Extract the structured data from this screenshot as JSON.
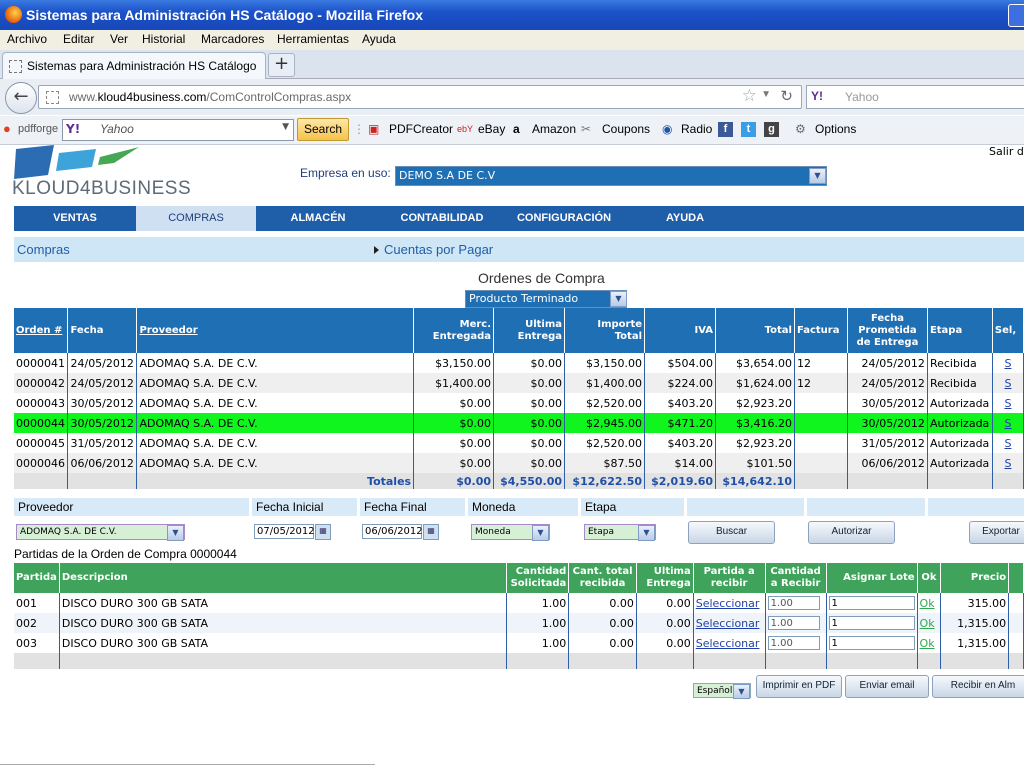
{
  "window": {
    "title": "Sistemas para Administración HS Catálogo - Mozilla Firefox"
  },
  "menubar": [
    "Archivo",
    "Editar",
    "Ver",
    "Historial",
    "Marcadores",
    "Herramientas",
    "Ayuda"
  ],
  "tab": {
    "label": "Sistemas para Administración HS Catálogo",
    "new_tab": "+"
  },
  "urlbar": {
    "prefix": "www.",
    "domain": "kloud4business.com",
    "path": "/ComControlCompras.aspx",
    "search_placeholder": "Yahoo",
    "search_engine": "Y!"
  },
  "toolbar": {
    "pdfforge": "pdfforge",
    "yahoo_logo": "Y!",
    "search_placeholder": "Yahoo",
    "search_button": "Search",
    "items": [
      "PDFCreator",
      "eBay",
      "Amazon",
      "Coupons",
      "Radio",
      "Options"
    ]
  },
  "app": {
    "logo": "KLOUD4BUSINESS",
    "empresa_label": "Empresa en uso:",
    "empresa_value": "DEMO S.A DE C.V",
    "salir": "Salir d",
    "nav": [
      "VENTAS",
      "COMPRAS",
      "ALMACÉN",
      "CONTABILIDAD",
      "CONFIGURACIÓN",
      "AYUDA"
    ],
    "breadcrumb": "Compras",
    "sublink": "Cuentas por Pagar"
  },
  "orders": {
    "title": "Ordenes de Compra",
    "tipo": "Producto Terminado",
    "headers": [
      "Orden #",
      "Fecha",
      "Proveedor",
      "Merc. Entregada",
      "Ultima Entrega",
      "Importe Total",
      "IVA",
      "Total",
      "Factura",
      "Fecha Prometida de Entrega",
      "Etapa",
      "Sel,"
    ],
    "rows": [
      {
        "orden": "0000041",
        "fecha": "24/05/2012",
        "proveedor": "ADOMAQ S.A. DE C.V.",
        "merc": "$3,150.00",
        "ultima": "$0.00",
        "importe": "$3,150.00",
        "iva": "$504.00",
        "total": "$3,654.00",
        "factura": "12",
        "prometida": "24/05/2012",
        "etapa": "Recibida",
        "sel": "S"
      },
      {
        "orden": "0000042",
        "fecha": "24/05/2012",
        "proveedor": "ADOMAQ S.A. DE C.V.",
        "merc": "$1,400.00",
        "ultima": "$0.00",
        "importe": "$1,400.00",
        "iva": "$224.00",
        "total": "$1,624.00",
        "factura": "12",
        "prometida": "24/05/2012",
        "etapa": "Recibida",
        "sel": "S"
      },
      {
        "orden": "0000043",
        "fecha": "30/05/2012",
        "proveedor": "ADOMAQ S.A. DE C.V.",
        "merc": "$0.00",
        "ultima": "$0.00",
        "importe": "$2,520.00",
        "iva": "$403.20",
        "total": "$2,923.20",
        "factura": "",
        "prometida": "30/05/2012",
        "etapa": "Autorizada",
        "sel": "S"
      },
      {
        "orden": "0000044",
        "fecha": "30/05/2012",
        "proveedor": "ADOMAQ S.A. DE C.V.",
        "merc": "$0.00",
        "ultima": "$0.00",
        "importe": "$2,945.00",
        "iva": "$471.20",
        "total": "$3,416.20",
        "factura": "",
        "prometida": "30/05/2012",
        "etapa": "Autorizada",
        "sel": "S"
      },
      {
        "orden": "0000045",
        "fecha": "31/05/2012",
        "proveedor": "ADOMAQ S.A. DE C.V.",
        "merc": "$0.00",
        "ultima": "$0.00",
        "importe": "$2,520.00",
        "iva": "$403.20",
        "total": "$2,923.20",
        "factura": "",
        "prometida": "31/05/2012",
        "etapa": "Autorizada",
        "sel": "S"
      },
      {
        "orden": "0000046",
        "fecha": "06/06/2012",
        "proveedor": "ADOMAQ S.A. DE C.V.",
        "merc": "$0.00",
        "ultima": "$0.00",
        "importe": "$87.50",
        "iva": "$14.00",
        "total": "$101.50",
        "factura": "",
        "prometida": "06/06/2012",
        "etapa": "Autorizada",
        "sel": "S"
      }
    ],
    "totals": {
      "label": "Totales",
      "merc": "$0.00",
      "ultima": "$4,550.00",
      "importe": "$12,622.50",
      "iva": "$2,019.60",
      "total": "$14,642.10"
    }
  },
  "filters": {
    "proveedor_label": "Proveedor",
    "fecha_inicial_label": "Fecha Inicial",
    "fecha_final_label": "Fecha Final",
    "moneda_label": "Moneda",
    "etapa_label": "Etapa",
    "proveedor": "ADOMAQ S.A. DE C.V.",
    "fecha_inicial": "07/05/2012",
    "fecha_final": "06/06/2012",
    "moneda": "Moneda",
    "etapa": "Etapa",
    "buscar": "Buscar",
    "autorizar": "Autorizar",
    "exportar": "Exportar"
  },
  "partidas": {
    "title": "Partidas de la Orden de Compra 0000044",
    "headers": [
      "Partida",
      "Descripcion",
      "Cantidad Solicitada",
      "Cant. total recibida",
      "Ultima Entrega",
      "Partida a recibir",
      "Cantidad a Recibir",
      "Asignar Lote",
      "Ok",
      "Precio"
    ],
    "rows": [
      {
        "partida": "001",
        "descripcion": "DISCO DURO 300 GB SATA",
        "solicitada": "1.00",
        "recibida": "0.00",
        "ultima": "0.00",
        "link": "Seleccionar",
        "cantidad": "1.00",
        "lote": "1",
        "ok": "Ok",
        "precio": "315.00"
      },
      {
        "partida": "002",
        "descripcion": "DISCO DURO 300 GB SATA",
        "solicitada": "1.00",
        "recibida": "0.00",
        "ultima": "0.00",
        "link": "Seleccionar",
        "cantidad": "1.00",
        "lote": "1",
        "ok": "Ok",
        "precio": "1,315.00"
      },
      {
        "partida": "003",
        "descripcion": "DISCO DURO 300 GB SATA",
        "solicitada": "1.00",
        "recibida": "0.00",
        "ultima": "0.00",
        "link": "Seleccionar",
        "cantidad": "1.00",
        "lote": "1",
        "ok": "Ok",
        "precio": "1,315.00"
      }
    ]
  },
  "footer": {
    "idioma": "Español",
    "imprimir": "Imprimir en PDF",
    "enviar": "Enviar email",
    "recibir": "Recibir en Alm"
  },
  "colors": {
    "header_blue": "#1f6fb5",
    "nav_blue": "#1f5ea8",
    "selected_row": "#11f51e",
    "partidas_green": "#3fa35b"
  }
}
